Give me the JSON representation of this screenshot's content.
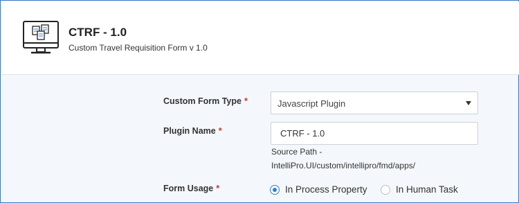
{
  "header": {
    "title": "CTRF - 1.0",
    "subtitle": "Custom Travel Requisition Form v 1.0",
    "icon": "monitor-forms-icon"
  },
  "form": {
    "form_type": {
      "label": "Custom Form Type",
      "required_mark": "*",
      "selected": "Javascript Plugin"
    },
    "plugin_name": {
      "label": "Plugin Name",
      "required_mark": "*",
      "value": "CTRF - 1.0"
    },
    "source_path": {
      "label": "Source Path -",
      "value": "IntelliPro.UI/custom/intellipro/fmd/apps/"
    },
    "form_usage": {
      "label": "Form Usage",
      "required_mark": "*",
      "options": [
        {
          "label": "In Process Property",
          "checked": true
        },
        {
          "label": "In Human Task",
          "checked": false
        }
      ]
    }
  },
  "colors": {
    "border": "#3a78c4",
    "required": "#d9312c",
    "radio_accent": "#2f7fd1",
    "page_background": "#f4f7fb"
  }
}
